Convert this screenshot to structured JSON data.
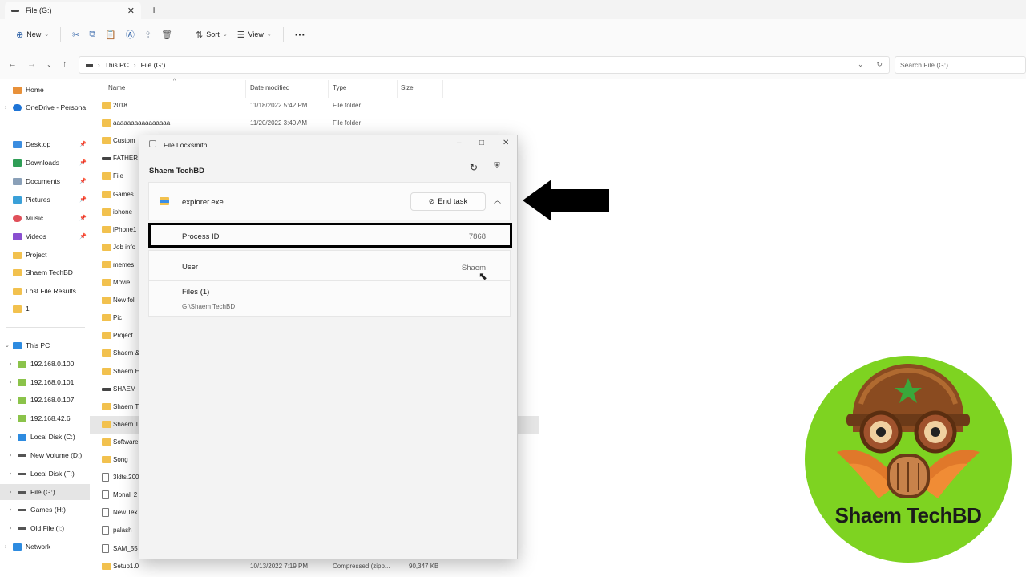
{
  "tab": {
    "title": "File (G:)"
  },
  "toolbar": {
    "new_label": "New",
    "sort_label": "Sort",
    "view_label": "View"
  },
  "address": {
    "this_pc": "This PC",
    "current": "File (G:)",
    "search_placeholder": "Search File (G:)"
  },
  "sidebar": {
    "items": [
      {
        "label": "Home",
        "icon": "home-icon"
      },
      {
        "label": "OneDrive - Persona",
        "icon": "cloud-icon"
      },
      {
        "label": "Desktop",
        "icon": "desktop-icon"
      },
      {
        "label": "Downloads",
        "icon": "download-icon"
      },
      {
        "label": "Documents",
        "icon": "document-icon"
      },
      {
        "label": "Pictures",
        "icon": "picture-icon"
      },
      {
        "label": "Music",
        "icon": "music-icon"
      },
      {
        "label": "Videos",
        "icon": "video-icon"
      },
      {
        "label": "Project",
        "icon": "folder-icon"
      },
      {
        "label": "Shaem TechBD",
        "icon": "folder-icon"
      },
      {
        "label": "Lost File Results",
        "icon": "folder-icon"
      },
      {
        "label": "1",
        "icon": "folder-icon"
      },
      {
        "label": "This PC",
        "icon": "computer-icon"
      },
      {
        "label": "192.168.0.100",
        "icon": "network-drive-icon"
      },
      {
        "label": "192.168.0.101",
        "icon": "network-drive-icon"
      },
      {
        "label": "192.168.0.107",
        "icon": "network-drive-icon"
      },
      {
        "label": "192.168.42.6",
        "icon": "network-drive-icon"
      },
      {
        "label": "Local Disk (C:)",
        "icon": "drive-icon"
      },
      {
        "label": "New Volume (D:)",
        "icon": "drive-icon"
      },
      {
        "label": "Local Disk (F:)",
        "icon": "drive-icon"
      },
      {
        "label": "File (G:)",
        "icon": "drive-icon"
      },
      {
        "label": "Games (H:)",
        "icon": "drive-icon"
      },
      {
        "label": "Old File (I:)",
        "icon": "drive-icon"
      },
      {
        "label": "Network",
        "icon": "network-icon"
      }
    ]
  },
  "files": {
    "columns": [
      "Name",
      "Date modified",
      "Type",
      "Size"
    ],
    "rows": [
      {
        "name": "2018",
        "date": "11/18/2022 5:42 PM",
        "type": "File folder",
        "size": ""
      },
      {
        "name": "aaaaaaaaaaaaaaaa",
        "date": "11/20/2022 3:40 AM",
        "type": "File folder",
        "size": ""
      },
      {
        "name": "Custom",
        "date": "",
        "type": "",
        "size": ""
      },
      {
        "name": "FATHER",
        "date": "",
        "type": "",
        "size": ""
      },
      {
        "name": "File",
        "date": "",
        "type": "",
        "size": ""
      },
      {
        "name": "Games",
        "date": "",
        "type": "",
        "size": ""
      },
      {
        "name": "iphone",
        "date": "",
        "type": "",
        "size": ""
      },
      {
        "name": "iPhone1",
        "date": "",
        "type": "",
        "size": ""
      },
      {
        "name": "Job info",
        "date": "",
        "type": "",
        "size": ""
      },
      {
        "name": "memes",
        "date": "",
        "type": "",
        "size": ""
      },
      {
        "name": "Movie",
        "date": "",
        "type": "",
        "size": ""
      },
      {
        "name": "New fol",
        "date": "",
        "type": "",
        "size": ""
      },
      {
        "name": "Pic",
        "date": "",
        "type": "",
        "size": ""
      },
      {
        "name": "Project",
        "date": "",
        "type": "",
        "size": ""
      },
      {
        "name": "Shaem &",
        "date": "",
        "type": "",
        "size": ""
      },
      {
        "name": "Shaem E",
        "date": "",
        "type": "",
        "size": ""
      },
      {
        "name": "SHAEM",
        "date": "",
        "type": "",
        "size": ""
      },
      {
        "name": "Shaem T",
        "date": "",
        "type": "",
        "size": ""
      },
      {
        "name": "Shaem T",
        "date": "",
        "type": "",
        "size": ""
      },
      {
        "name": "Software",
        "date": "",
        "type": "",
        "size": ""
      },
      {
        "name": "Song",
        "date": "",
        "type": "",
        "size": ""
      },
      {
        "name": "3ldts.200",
        "date": "",
        "type": "",
        "size": ""
      },
      {
        "name": "Monali 2",
        "date": "",
        "type": "",
        "size": ""
      },
      {
        "name": "New Tex",
        "date": "",
        "type": "",
        "size": ""
      },
      {
        "name": "palash",
        "date": "",
        "type": "",
        "size": ""
      },
      {
        "name": "SAM_55",
        "date": "",
        "type": "",
        "size": ""
      },
      {
        "name": "Setup1.0",
        "date": "10/13/2022 7:19 PM",
        "type": "Compressed (zipp...",
        "size": "90,347 KB"
      }
    ]
  },
  "dialog": {
    "title": "File Locksmith",
    "heading": "Shaem TechBD",
    "process_name": "explorer.exe",
    "end_task_label": "End task",
    "pid_label": "Process ID",
    "pid_value": "7868",
    "user_label": "User",
    "user_value": "Shaem",
    "files_label": "Files (1)",
    "file_path": "G:\\Shaem TechBD"
  },
  "logo": {
    "text": "Shaem TechBD"
  },
  "colors": {
    "folder": "#f2c14e",
    "selection": "#e5e5e5",
    "accent": "#2b5fa6",
    "logo_green": "#7ed321"
  }
}
